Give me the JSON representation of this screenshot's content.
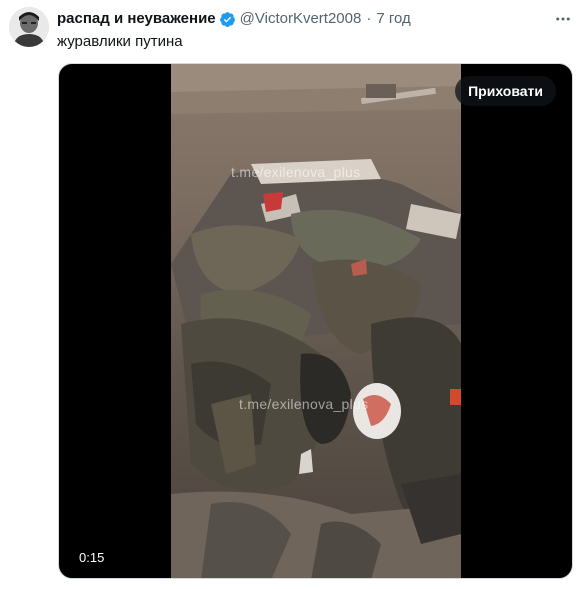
{
  "tweet": {
    "author_name": "распад и неуважение",
    "handle": "@VictorKvert2008",
    "separator": "·",
    "time": "7 год",
    "text": "журавлики путина"
  },
  "media": {
    "hide_label": "Приховати",
    "duration": "0:15",
    "watermark_top": "t.me/exilenova_plus",
    "watermark_bottom": "t.me/exilenova_plus"
  },
  "colors": {
    "verified": "#1d9bf0",
    "secondary_text": "#536471",
    "primary_text": "#0f1419"
  },
  "icons": {
    "verified": "verified-badge-icon",
    "more": "more-options-icon"
  }
}
